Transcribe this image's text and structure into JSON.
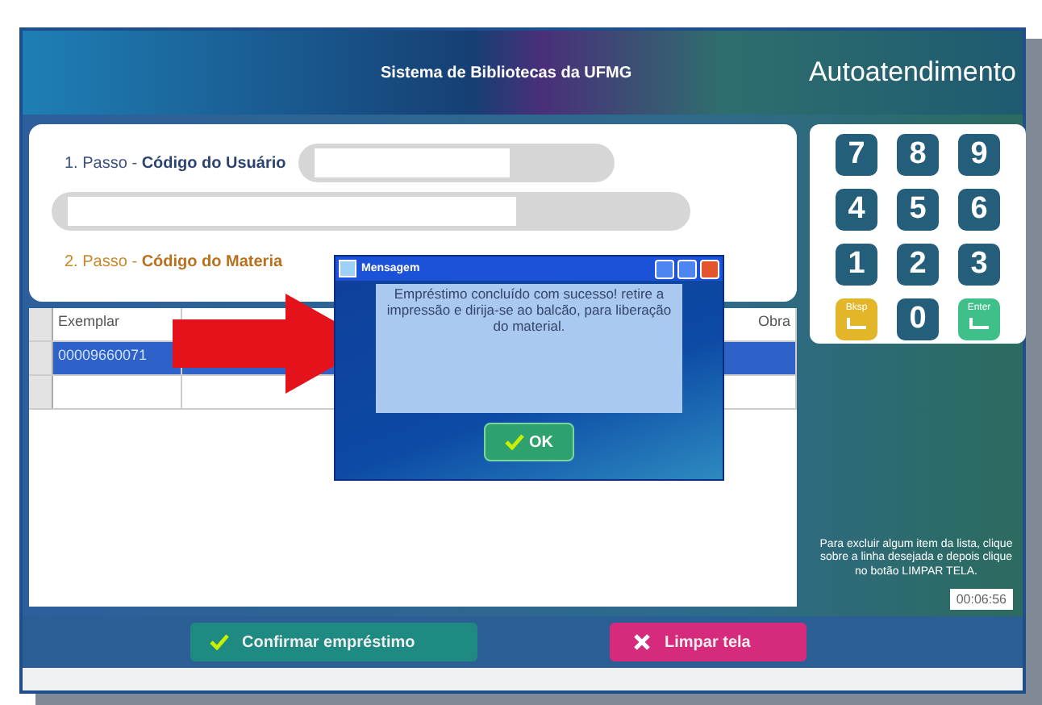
{
  "header": {
    "system_title": "Sistema de Bibliotecas da UFMG",
    "app_title": "Autoatendimento"
  },
  "step1": {
    "prefix": "1. Passo - ",
    "label": "Código do Usuário"
  },
  "step2": {
    "prefix": "2. Passo - ",
    "label": "Código do Materia"
  },
  "table": {
    "columns": [
      "Exemplar",
      "Obra"
    ],
    "rows": [
      {
        "cells": [
          "00009660071",
          ""
        ],
        "selected": true
      },
      {
        "cells": [
          "",
          ""
        ],
        "selected": false
      }
    ]
  },
  "keypad": [
    {
      "label": "7",
      "kind": "digit"
    },
    {
      "label": "8",
      "kind": "digit"
    },
    {
      "label": "9",
      "kind": "digit"
    },
    {
      "label": "4",
      "kind": "digit"
    },
    {
      "label": "5",
      "kind": "digit"
    },
    {
      "label": "6",
      "kind": "digit"
    },
    {
      "label": "1",
      "kind": "digit"
    },
    {
      "label": "2",
      "kind": "digit"
    },
    {
      "label": "3",
      "kind": "digit"
    },
    {
      "label": "Bksp",
      "kind": "back"
    },
    {
      "label": "0",
      "kind": "digit"
    },
    {
      "label": "Enter",
      "kind": "enter"
    }
  ],
  "hint": "Para excluir algum item da lista, clique sobre a linha desejada e depois clique no botão LIMPAR TELA.",
  "clock": "00:06:56",
  "dialog": {
    "title": "Mensagem",
    "message": "Empréstimo concluído com sucesso! retire a impressão e dirija-se ao balcão, para liberação do material.",
    "button": "OK"
  },
  "buttons": [
    {
      "label": "Confirmar empréstimo",
      "kind": "confirm"
    },
    {
      "label": "Limpar tela",
      "kind": "clear"
    }
  ]
}
